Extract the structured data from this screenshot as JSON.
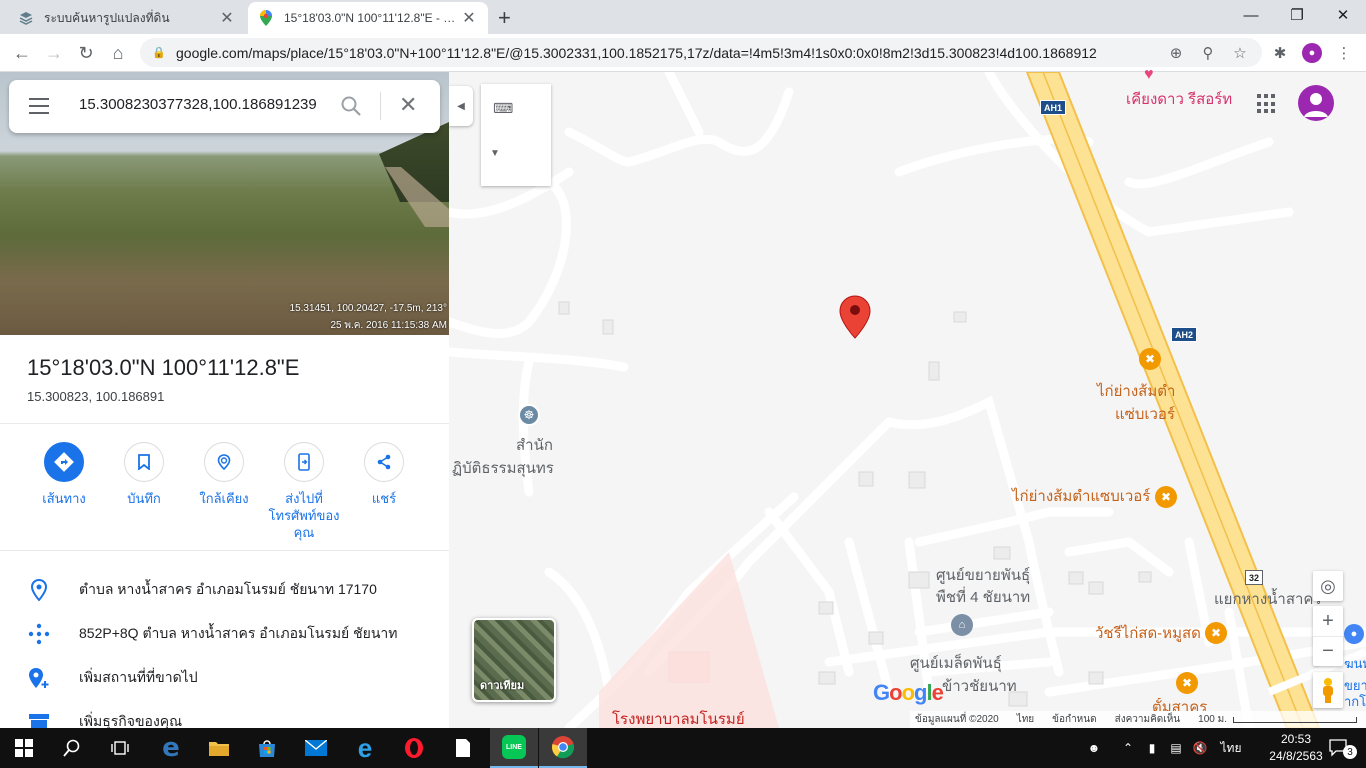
{
  "tabs": [
    {
      "title": "ระบบค้นหารูปแปลงที่ดิน",
      "close": "✕"
    },
    {
      "title": "15°18'03.0\"N 100°11'12.8\"E - Google",
      "close": "✕"
    }
  ],
  "new_tab": "+",
  "url": "google.com/maps/place/15°18'03.0\"N+100°11'12.8\"E/@15.3002331,100.1852175,17z/data=!4m5!3m4!1s0x0:0x0!8m2!3d15.300823!4d100.1868912",
  "search": {
    "query": "15.3008230377328,100.186891239"
  },
  "photo_caption": {
    "line1": "15.31451, 100.20427, -17.5m, 213°",
    "line2": "25 พ.ค. 2016 11:15:38 AM"
  },
  "place": {
    "title": "15°18'03.0\"N 100°11'12.8\"E",
    "subtitle": "15.300823, 100.186891"
  },
  "actions": [
    {
      "label": "เส้นทาง"
    },
    {
      "label": "บันทึก"
    },
    {
      "label": "ใกล้เคียง"
    },
    {
      "label": "ส่งไปที่โทรศัพท์ของคุณ"
    },
    {
      "label": "แชร์"
    }
  ],
  "info": [
    {
      "text": "ตำบล หางน้ำสาคร อำเภอมโนรมย์ ชัยนาท 17170"
    },
    {
      "text": "852P+8Q ตำบล หางน้ำสาคร อำเภอมโนรมย์ ชัยนาท"
    },
    {
      "text": "เพิ่มสถานที่ที่ขาดไป"
    },
    {
      "text": "เพิ่มธุรกิจของคุณ"
    }
  ],
  "map_labels": {
    "resort": "เคียงดาว รีสอร์ท",
    "temple_1": "สำนัก",
    "temple_2": "ฏิบัติธรรมสุนทร",
    "food1_1": "ไก่ย่างส้มตำ",
    "food1_2": "แซ่บเวอร์",
    "food2": "ไก่ย่างส้มตำแซบเวอร์",
    "center1_1": "ศูนย์ขยายพันธุ์",
    "center1_2": "พืชที่ 4 ชัยนาท",
    "center2_1": "ศูนย์เมล็ดพันธุ์",
    "center2_2": "ข้าวชัยนาท",
    "junction": "แยกหางน้ำสาคร",
    "pork": "วัชรีไก่สด-หมูสด",
    "cut1": "ตั้มสาคร",
    "hospital": "โรงพยาบาลมโนรมย์",
    "edge1": "ฆนท",
    "edge2": "ขยาย",
    "edge3": "ากโรง"
  },
  "shields": {
    "ah1": "AH1",
    "ah2": "AH2",
    "r32": "32"
  },
  "satellite_label": "ดาวเทียม",
  "google_logo": "Google",
  "attribution": {
    "data": "ข้อมูลแผนที่ ©2020",
    "lang": "ไทย",
    "terms": "ข้อกำหนด",
    "feedback": "ส่งความคิดเห็น",
    "scale": "100 ม."
  },
  "clock": {
    "time": "20:53",
    "date": "24/8/2563"
  },
  "tray": {
    "lang": "ไทย",
    "notifications": "3"
  },
  "colors": {
    "accent": "#1a73e8",
    "pin": "#ea4335",
    "road": "#fde293",
    "taskbar": "#101010"
  }
}
